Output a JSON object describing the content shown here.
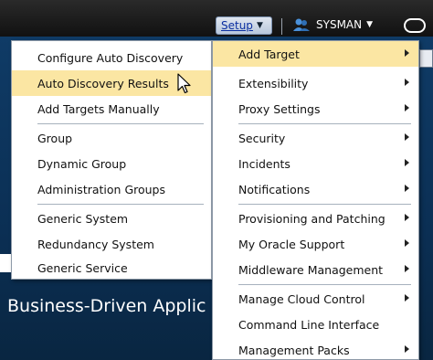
{
  "topbar": {
    "setup_label": "Setup",
    "user_label": "SYSMAN"
  },
  "background": {
    "heading": "Business-Driven Applic"
  },
  "setup_menu": {
    "items": [
      {
        "label": "Add Target",
        "submenu": true,
        "highlighted": true
      },
      {
        "label": "Extensibility",
        "submenu": true
      },
      {
        "label": "Proxy Settings",
        "submenu": true
      },
      {
        "label": "Security",
        "submenu": true
      },
      {
        "label": "Incidents",
        "submenu": true
      },
      {
        "label": "Notifications",
        "submenu": true
      },
      {
        "label": "Provisioning and Patching",
        "submenu": true
      },
      {
        "label": "My Oracle Support",
        "submenu": true
      },
      {
        "label": "Middleware Management",
        "submenu": true
      },
      {
        "label": "Manage Cloud Control",
        "submenu": true
      },
      {
        "label": "Command Line Interface",
        "submenu": false
      },
      {
        "label": "Management Packs",
        "submenu": true
      }
    ]
  },
  "add_target_menu": {
    "items": [
      {
        "label": "Configure Auto Discovery"
      },
      {
        "label": "Auto Discovery Results",
        "highlighted": true
      },
      {
        "label": "Add Targets Manually"
      },
      {
        "label": "Group"
      },
      {
        "label": "Dynamic Group"
      },
      {
        "label": "Administration Groups"
      },
      {
        "label": "Generic System"
      },
      {
        "label": "Redundancy System"
      },
      {
        "label": "Generic Service"
      }
    ]
  },
  "colors": {
    "highlight": "#fbe6a3",
    "topbar": "#1a1a1a",
    "page_background": "#0f3b66"
  },
  "icons": [
    "user-icon",
    "pointer-cursor-icon",
    "submenu-arrow-icon",
    "chevron-down-icon"
  ]
}
